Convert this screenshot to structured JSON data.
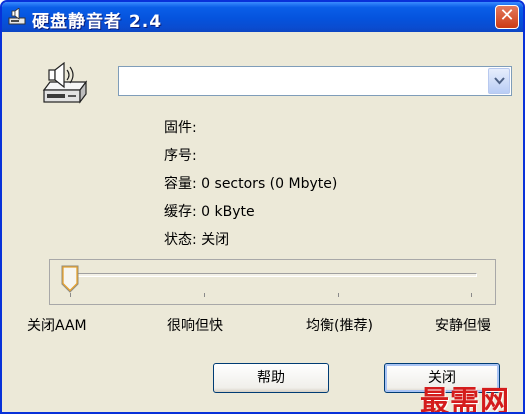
{
  "window": {
    "title": "硬盘静音者 2.4",
    "close_glyph": "✕"
  },
  "drive_combo": {
    "value": ""
  },
  "info": {
    "firmware": "固件:",
    "serial": "序号:",
    "capacity": "容量: 0 sectors (0 Mbyte)",
    "cache": "缓存: 0 kByte",
    "status": "状态: 关闭"
  },
  "slider": {
    "labels": [
      "关闭AAM",
      "很响但快",
      "均衡(推荐)",
      "安静但慢"
    ],
    "level": 0
  },
  "buttons": {
    "help": "帮助",
    "close": "关闭"
  },
  "watermark": "最需网",
  "colors": {
    "titlebar": "#0553dd",
    "window_border": "#0831d9",
    "close_button": "#cc3a14",
    "face": "#ece9d8"
  }
}
